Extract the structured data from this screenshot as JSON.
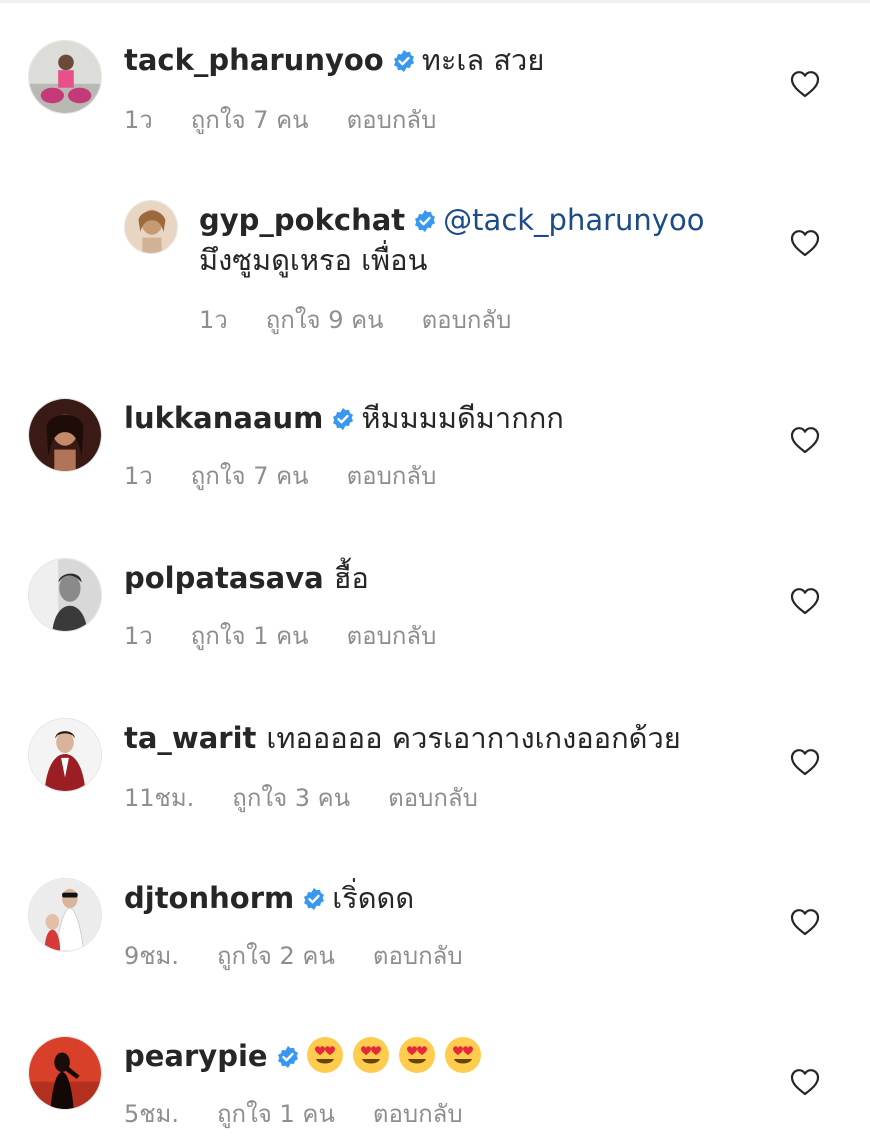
{
  "comments": [
    {
      "username": "tack_pharunyoo",
      "verified": true,
      "text": "ทะเล สวย",
      "time": "1ว",
      "likes": "ถูกใจ 7 คน",
      "reply_label": "ตอบกลับ"
    },
    {
      "username": "gyp_pokchat",
      "verified": true,
      "mention": "@tack_pharunyoo",
      "text": "มึงซูมดูเหรอ เพื่อน",
      "time": "1ว",
      "likes": "ถูกใจ 9 คน",
      "reply_label": "ตอบกลับ",
      "is_reply": true
    },
    {
      "username": "lukkanaaum",
      "verified": true,
      "text": "หีมมมมดีมากกก",
      "time": "1ว",
      "likes": "ถูกใจ 7 คน",
      "reply_label": "ตอบกลับ"
    },
    {
      "username": "polpatasava",
      "verified": false,
      "text": "ฮื้อ",
      "time": "1ว",
      "likes": "ถูกใจ 1 คน",
      "reply_label": "ตอบกลับ"
    },
    {
      "username": "ta_warit",
      "verified": false,
      "text": "เทอออออ ควรเอากางเกงออกด้วย",
      "time": "11ชม.",
      "likes": "ถูกใจ 3 คน",
      "reply_label": "ตอบกลับ"
    },
    {
      "username": "djtonhorm",
      "verified": true,
      "text": "เริ่ดดด",
      "time": "9ชม.",
      "likes": "ถูกใจ 2 คน",
      "reply_label": "ตอบกลับ"
    },
    {
      "username": "pearypie",
      "verified": true,
      "text": "",
      "emoji": "heart-eyes-emoji",
      "emoji_count": 4,
      "time": "5ชม.",
      "likes": "ถูกใจ 1 คน",
      "reply_label": "ตอบกลับ"
    }
  ],
  "icons": {
    "verified": "verified-badge-icon",
    "like": "heart-outline-icon"
  },
  "colors": {
    "verified": "#3897f0",
    "mention": "#1c4b87",
    "meta": "#8e8e8e"
  }
}
